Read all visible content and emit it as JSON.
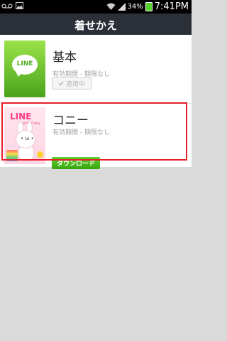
{
  "status": {
    "battery_percent": "34%",
    "time": "7:41PM"
  },
  "header": {
    "title": "着せかえ"
  },
  "themes": [
    {
      "title": "基本",
      "thumb_text": "LINE",
      "period": "有効期間 - 期限なし",
      "status_label": "適用中"
    },
    {
      "title": "コニー",
      "thumb_text": "LINE",
      "thumb_sub": "with Cony",
      "period": "有効期間 - 期限なし",
      "action_label": "ダウンロード"
    }
  ],
  "colors": {
    "accent_green": "#3fb01a",
    "highlight": "#e51f2b",
    "titlebar": "#2b2f37"
  }
}
